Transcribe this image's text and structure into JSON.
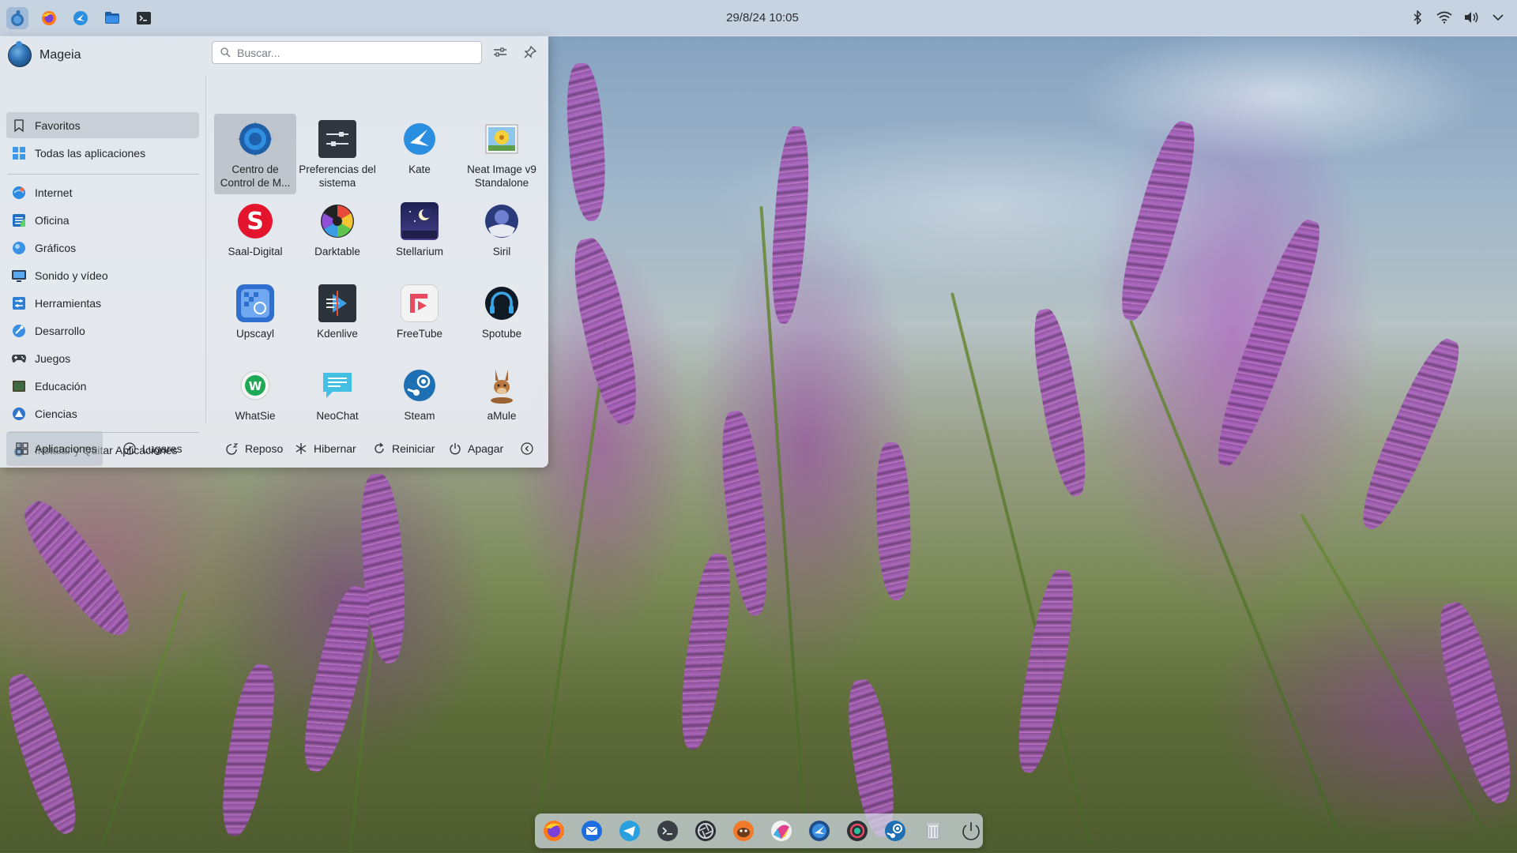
{
  "panel": {
    "clock": "29/8/24 10:05",
    "launchers": [
      "mageia-menu-icon",
      "firefox-icon",
      "kate-icon",
      "file-manager-icon",
      "terminal-icon"
    ],
    "tray": [
      "bluetooth-icon",
      "wifi-icon",
      "volume-icon",
      "chevron-down-icon"
    ]
  },
  "menu": {
    "user": "Mageia",
    "search_placeholder": "Buscar...",
    "categories": [
      {
        "label": "Favoritos",
        "icon": "bookmark-icon",
        "selected": true
      },
      {
        "label": "Todas las aplicaciones",
        "icon": "all-apps-icon"
      },
      {
        "label": "Internet",
        "icon": "internet-icon"
      },
      {
        "label": "Oficina",
        "icon": "office-icon"
      },
      {
        "label": "Gráficos",
        "icon": "graphics-icon"
      },
      {
        "label": "Sonido y vídeo",
        "icon": "multimedia-icon"
      },
      {
        "label": "Herramientas",
        "icon": "tools-icon"
      },
      {
        "label": "Desarrollo",
        "icon": "development-icon"
      },
      {
        "label": "Juegos",
        "icon": "games-icon"
      },
      {
        "label": "Educación",
        "icon": "education-icon"
      },
      {
        "label": "Ciencias",
        "icon": "science-icon"
      },
      {
        "label": "Instalar y Quitar Aplicaciones",
        "icon": "install-remove-icon"
      }
    ],
    "apps": [
      {
        "label": "Centro de Control de M...",
        "icon": "control-center-icon",
        "selected": true
      },
      {
        "label": "Preferencias del sistema",
        "icon": "system-settings-icon"
      },
      {
        "label": "Kate",
        "icon": "kate-icon"
      },
      {
        "label": "Neat Image v9 Standalone",
        "icon": "neat-image-icon"
      },
      {
        "label": "Saal-Digital",
        "icon": "saal-digital-icon"
      },
      {
        "label": "Darktable",
        "icon": "darktable-icon"
      },
      {
        "label": "Stellarium",
        "icon": "stellarium-icon"
      },
      {
        "label": "Siril",
        "icon": "siril-icon"
      },
      {
        "label": "Upscayl",
        "icon": "upscayl-icon"
      },
      {
        "label": "Kdenlive",
        "icon": "kdenlive-icon"
      },
      {
        "label": "FreeTube",
        "icon": "freetube-icon"
      },
      {
        "label": "Spotube",
        "icon": "spotube-icon"
      },
      {
        "label": "WhatSie",
        "icon": "whatsie-icon"
      },
      {
        "label": "NeoChat",
        "icon": "neochat-icon"
      },
      {
        "label": "Steam",
        "icon": "steam-icon"
      },
      {
        "label": "aMule",
        "icon": "amule-icon"
      }
    ],
    "footer": {
      "applications": "Aplicaciones",
      "places": "Lugares",
      "sleep": "Reposo",
      "hibernate": "Hibernar",
      "restart": "Reiniciar",
      "shutdown": "Apagar"
    }
  },
  "dock": {
    "items": [
      "firefox-icon",
      "thunderbird-icon",
      "telegram-icon",
      "terminal-icon",
      "aperture-icon",
      "game-icon",
      "paint-icon",
      "kate-icon",
      "record-icon",
      "steam-icon",
      "trash-icon",
      "power-icon"
    ]
  },
  "colors": {
    "accent": "#3daee9",
    "menu_bg": "#e8ecf1",
    "panel_bg": "#d6dee8"
  }
}
